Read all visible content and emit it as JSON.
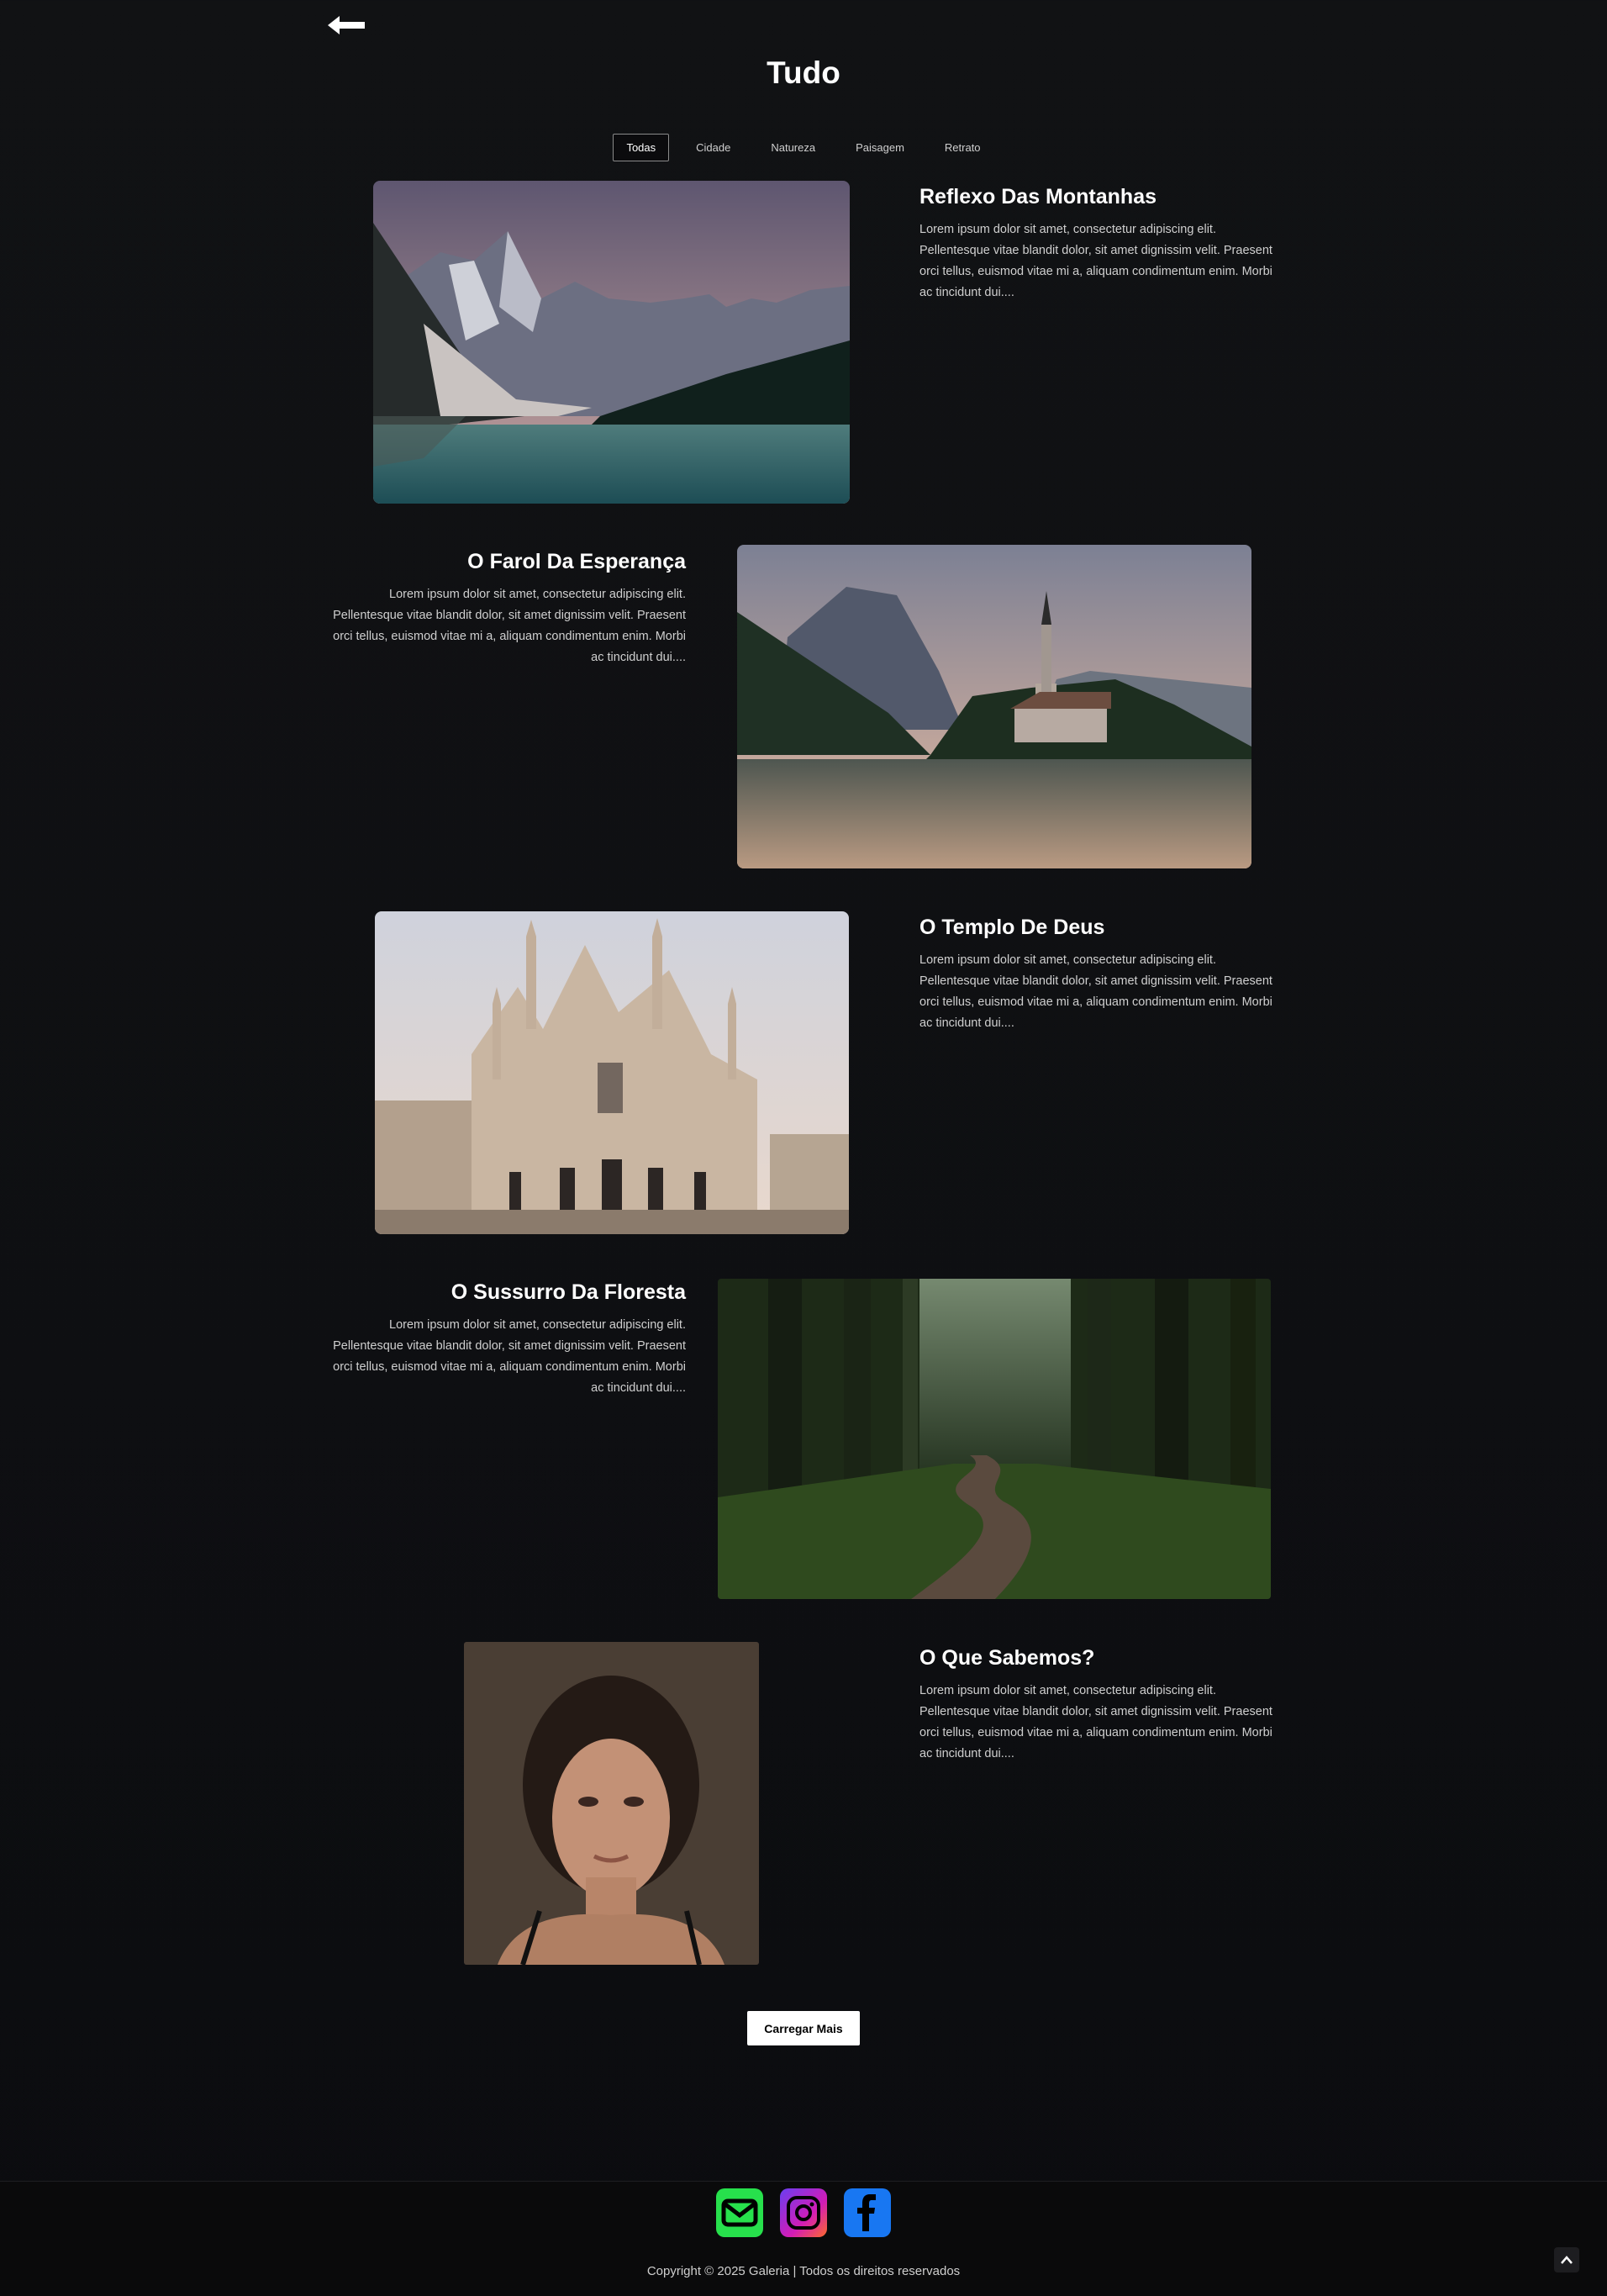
{
  "page": {
    "title": "Tudo"
  },
  "icons": {
    "back": "arrow-left-icon",
    "email": "envelope-icon",
    "instagram": "instagram-icon",
    "facebook": "facebook-icon",
    "scroll_top": "chevron-up-icon"
  },
  "colors": {
    "background": "#111214",
    "email_green": "#27e04c",
    "instagram_purple": "#9b2bd6",
    "facebook_blue": "#1877f2"
  },
  "filters": [
    {
      "label": "Todas",
      "active": true
    },
    {
      "label": "Cidade",
      "active": false
    },
    {
      "label": "Natureza",
      "active": false
    },
    {
      "label": "Paisagem",
      "active": false
    },
    {
      "label": "Retrato",
      "active": false
    }
  ],
  "items": [
    {
      "title": "Reflexo Das Montanhas",
      "desc": "Lorem ipsum dolor sit amet, consectetur adipiscing elit. Pellentesque vitae blandit dolor, sit amet dignissim velit. Praesent orci tellus, euismod vitae mi a, aliquam condimentum enim. Morbi ac tincidunt dui...."
    },
    {
      "title": "O Farol Da Esperança",
      "desc": "Lorem ipsum dolor sit amet, consectetur adipiscing elit. Pellentesque vitae blandit dolor, sit amet dignissim velit. Praesent orci tellus, euismod vitae mi a, aliquam condimentum enim. Morbi ac tincidunt dui...."
    },
    {
      "title": "O Templo De Deus",
      "desc": "Lorem ipsum dolor sit amet, consectetur adipiscing elit. Pellentesque vitae blandit dolor, sit amet dignissim velit. Praesent orci tellus, euismod vitae mi a, aliquam condimentum enim. Morbi ac tincidunt dui...."
    },
    {
      "title": "O Sussurro Da Floresta",
      "desc": "Lorem ipsum dolor sit amet, consectetur adipiscing elit. Pellentesque vitae blandit dolor, sit amet dignissim velit. Praesent orci tellus, euismod vitae mi a, aliquam condimentum enim. Morbi ac tincidunt dui...."
    },
    {
      "title": "O Que Sabemos?",
      "desc": "Lorem ipsum dolor sit amet, consectetur adipiscing elit. Pellentesque vitae blandit dolor, sit amet dignissim velit. Praesent orci tellus, euismod vitae mi a, aliquam condimentum enim. Morbi ac tincidunt dui...."
    }
  ],
  "load_more": "Carregar Mais",
  "footer": {
    "copyright": "Copyright © 2025 Galeria | Todos os direitos reservados"
  }
}
